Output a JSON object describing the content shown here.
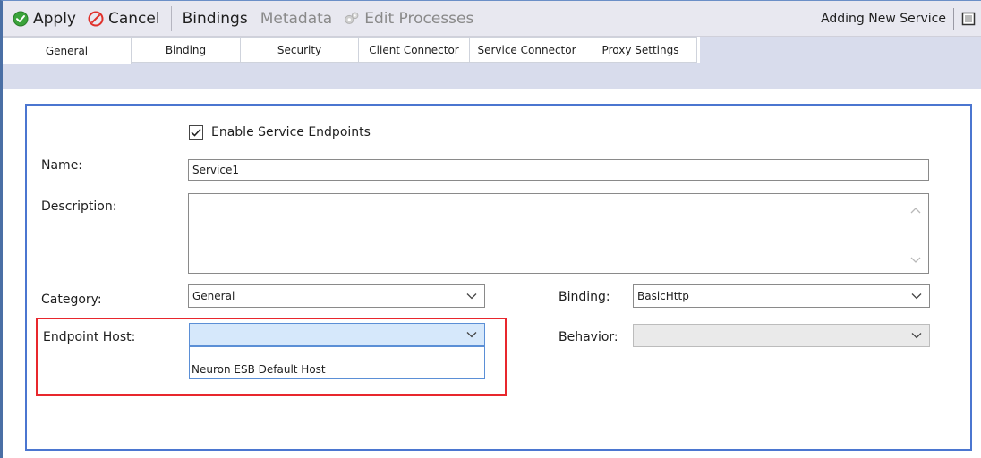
{
  "toolbar": {
    "apply_label": "Apply",
    "cancel_label": "Cancel",
    "bindings_label": "Bindings",
    "metadata_label": "Metadata",
    "edit_processes_label": "Edit Processes",
    "status_text": "Adding New Service"
  },
  "tabs": [
    {
      "label": "General",
      "active": true
    },
    {
      "label": "Binding",
      "active": false
    },
    {
      "label": "Security",
      "active": false
    },
    {
      "label": "Client Connector",
      "active": false
    },
    {
      "label": "Service Connector",
      "active": false
    },
    {
      "label": "Proxy Settings",
      "active": false
    }
  ],
  "form": {
    "enable_label": "Enable Service Endpoints",
    "enable_checked": true,
    "name_label": "Name:",
    "name_value": "Service1",
    "description_label": "Description:",
    "description_value": "",
    "category_label": "Category:",
    "category_value": "General",
    "binding_label": "Binding:",
    "binding_value": "BasicHttp",
    "endpoint_host_label": "Endpoint Host:",
    "endpoint_host_value": "",
    "behavior_label": "Behavior:",
    "behavior_value": "",
    "endpoint_host_options": [
      "Neuron ESB Default Host"
    ]
  },
  "colors": {
    "apply_icon": "#3aa33a",
    "cancel_icon": "#e0302a",
    "panel_border": "#4b76d0",
    "highlight": "#e8272d",
    "tab_strip": "#d8dcec"
  }
}
